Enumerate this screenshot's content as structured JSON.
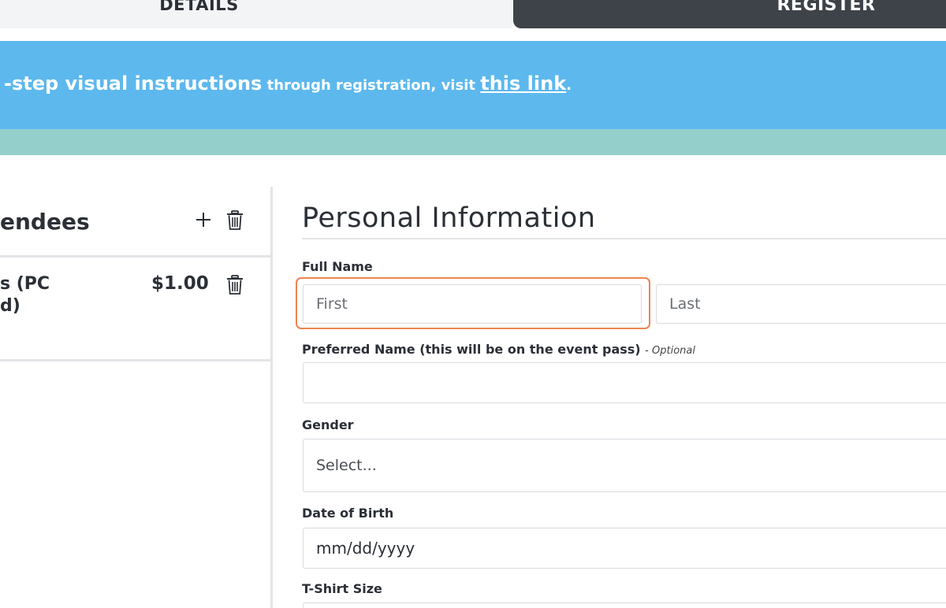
{
  "tabs": {
    "details": "DETAILS",
    "register": "REGISTER"
  },
  "banner": {
    "strong_text": "-step visual instructions",
    "mid_text": " through registration, visit ",
    "link_text": "this link",
    "end_text": "."
  },
  "left_panel": {
    "attendees_title": "endees",
    "add_icon": "plus-icon",
    "delete_icon": "trash-icon",
    "item_name": "s (PC\nd)",
    "item_price": "$1.00"
  },
  "form": {
    "section_title": "Personal Information",
    "full_name_label": "Full Name",
    "first_placeholder": "First",
    "last_placeholder": "Last",
    "preferred_label": "Preferred Name (this will be on the event pass)",
    "optional_text": "- Optional",
    "gender_label": "Gender",
    "gender_value": "Select...",
    "dob_label": "Date of Birth",
    "dob_value": "mm/dd/yyyy",
    "tshirt_label": "T-Shirt Size"
  },
  "colors": {
    "banner": "#5db8ee",
    "banner_strip": "#95cfcb",
    "register_tab": "#3e434a",
    "focus_ring": "#ee8450"
  }
}
